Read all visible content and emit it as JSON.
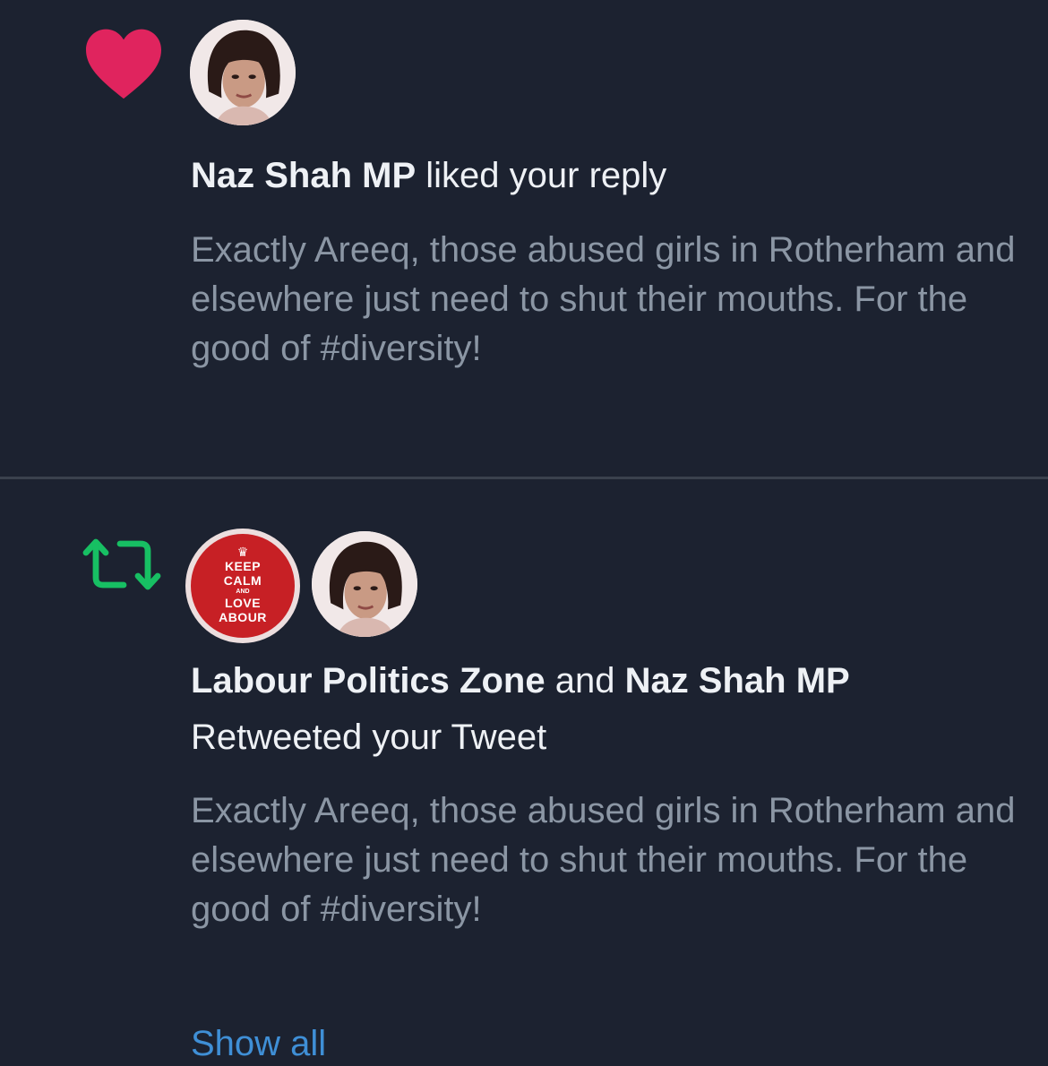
{
  "notifications": [
    {
      "type_icon": "heart-icon",
      "actor_1": "Naz Shah MP",
      "action": " liked your reply",
      "text": "Exactly Areeq, those abused girls in Rotherham and elsewhere just need to shut their mouths. For the good of #diversity!"
    },
    {
      "type_icon": "retweet-icon",
      "badge": {
        "line1": "KEEP",
        "line2": "CALM",
        "small": "AND",
        "line3": "LOVE",
        "line4": "ABOUR"
      },
      "actor_1": "Labour Politics Zone",
      "joiner": " and ",
      "actor_2": "Naz Shah MP",
      "action": " Retweeted your Tweet",
      "text": "Exactly Areeq, those abused girls in Rotherham and elsewhere just need to shut their mouths. For the good of #diversity!",
      "show_all": "Show all"
    }
  ],
  "colors": {
    "background": "#1c2230",
    "heart": "#e0245e",
    "retweet": "#17bf63",
    "link": "#3f8fd6"
  }
}
